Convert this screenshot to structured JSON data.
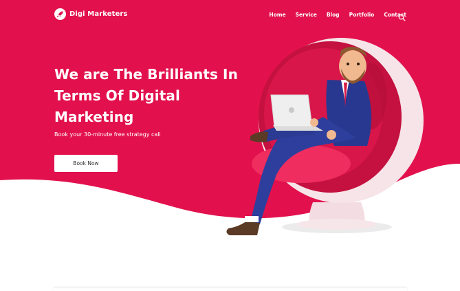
{
  "theme": {
    "brand": "#e2114d",
    "text_on_brand": "#ffffff",
    "button_text": "#2a2a2a"
  },
  "header": {
    "logo_text": "Digi Marketers",
    "logo_icon": "rocket-icon",
    "nav": [
      "Home",
      "Service",
      "Blog",
      "Portfolio",
      "Contact"
    ],
    "search_icon": "search-icon"
  },
  "hero": {
    "title_lines": [
      "We are The Brilliants In",
      "Terms Of Digital",
      "Marketing"
    ],
    "subtitle": "Book your 30-minute free strategy call",
    "cta_label": "Book Now"
  }
}
